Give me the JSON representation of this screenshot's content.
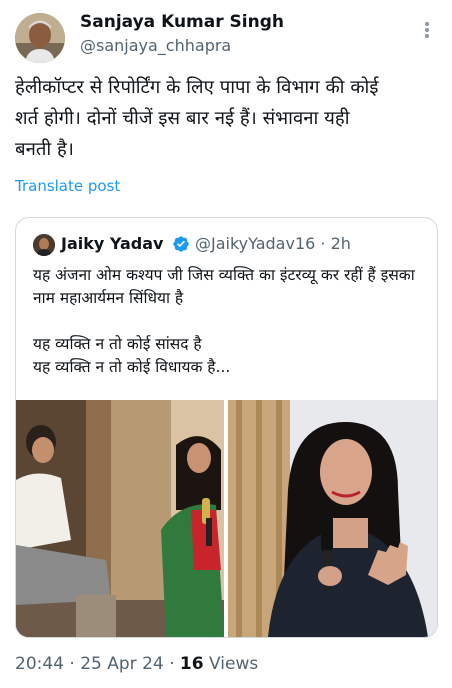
{
  "author": {
    "name": "Sanjaya Kumar Singh",
    "handle": "@sanjaya_chhapra"
  },
  "tweet": {
    "lines": [
      "हेलीकॉप्टर से रिपोर्टिंग के लिए पापा के विभाग की कोई",
      "शर्त होगी। दोनों चीजें इस बार नई हैं। संभावना यही",
      "बनती है।"
    ],
    "translate_label": "Translate post"
  },
  "quote": {
    "name": "Jaiky Yadav",
    "handle": "@JaikyYadav16",
    "time": "2h",
    "paragraph1": "यह अंजना ओम कश्यप जी जिस व्यक्ति का इंटरव्यू कर रहीं हैं इसका नाम महाआर्यमन सिंधिया है",
    "line2": "यह व्यक्ति न तो कोई सांसद है",
    "line3": "यह व्यक्ति न तो कोई विधायक है..."
  },
  "meta": {
    "time": "20:44",
    "date": "25 Apr 24",
    "views_count": "16",
    "views_label": "Views"
  },
  "colors": {
    "accent": "#1d9bf0",
    "text": "#0f1419",
    "secondary": "#536471",
    "border": "#cfd9de"
  },
  "icons": {
    "more": "more-icon",
    "verified": "verified-badge-icon"
  }
}
